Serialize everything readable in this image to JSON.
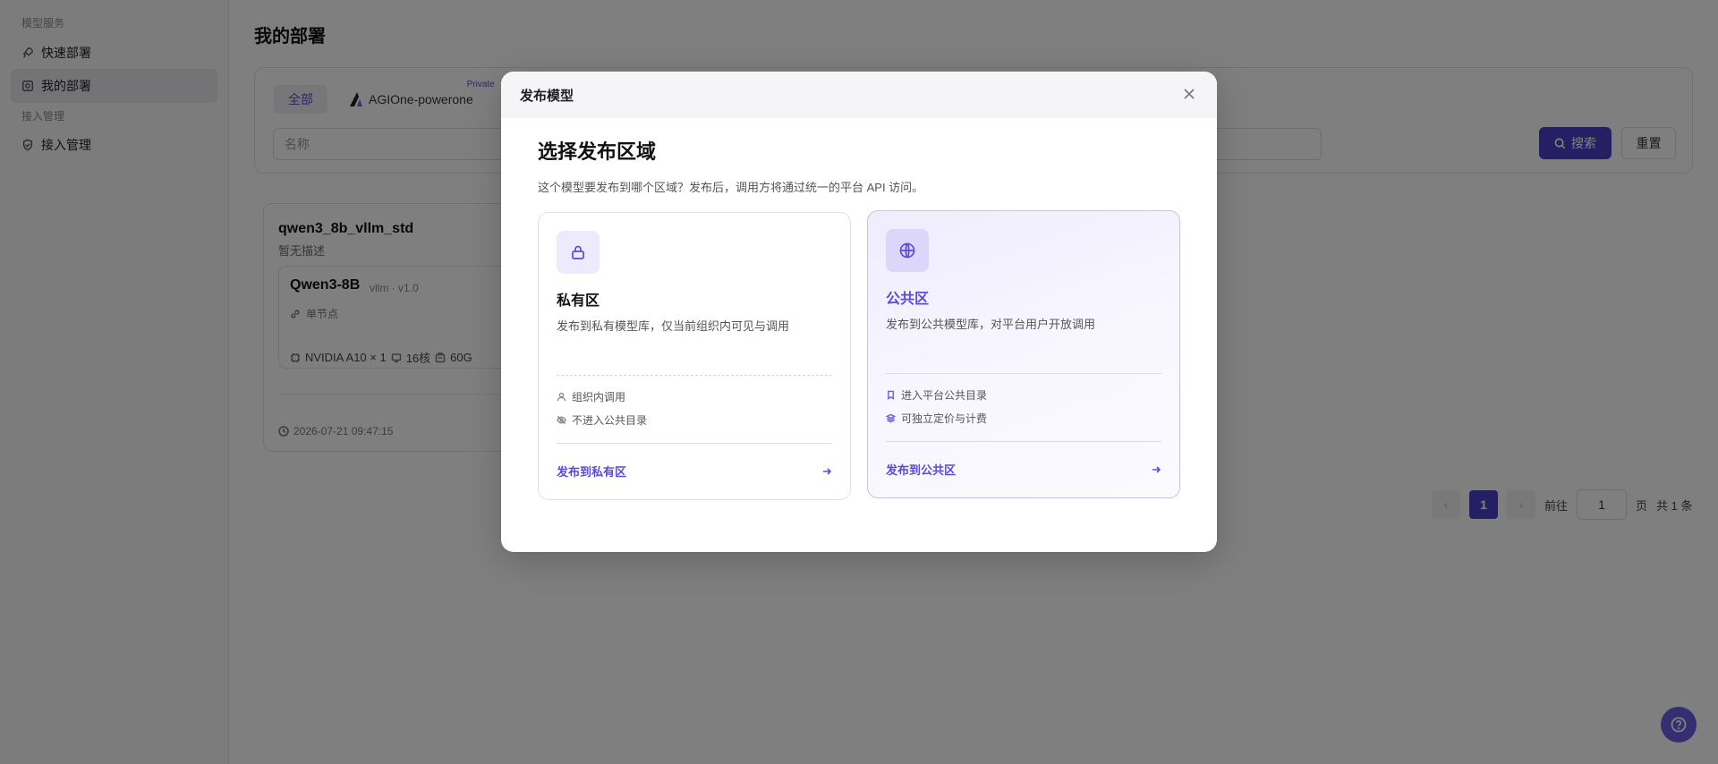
{
  "sidebar": {
    "group_model_service": "模型服务",
    "items": [
      {
        "label": "快速部署",
        "icon": "rocket-icon"
      },
      {
        "label": "我的部署",
        "icon": "deploy-icon",
        "active": true
      }
    ],
    "group_access": "接入管理",
    "access_items": [
      {
        "label": "接入管理",
        "icon": "shield-check-icon"
      }
    ]
  },
  "main": {
    "title": "我的部署",
    "tabs": [
      {
        "label": "全部",
        "active": true
      },
      {
        "label": "AGIOne-powerone",
        "badge": "Private"
      }
    ],
    "name_placeholder": "名称",
    "search_label": "搜索",
    "reset_label": "重置"
  },
  "deployment": {
    "name": "qwen3_8b_vllm_std",
    "description": "暂无描述",
    "model_name": "Qwen3-8B",
    "model_meta": "vllm · v1.0",
    "node_type": "单节点",
    "gpu": "NVIDIA A10 × 1",
    "cpu": "16核",
    "memory": "60G",
    "created_at": "2026-07-21 09:47:15"
  },
  "pagination": {
    "current_page": "1",
    "goto_label": "前往",
    "goto_value": "1",
    "page_label": "页",
    "total_label": "共 1 条"
  },
  "modal": {
    "title": "发布模型",
    "heading": "选择发布区域",
    "subtitle": "这个模型要发布到哪个区域？发布后，调用方将通过统一的平台 API 访问。",
    "private": {
      "title": "私有区",
      "description": "发布到私有模型库，仅当前组织内可见与调用",
      "features": [
        "组织内调用",
        "不进入公共目录"
      ],
      "action": "发布到私有区"
    },
    "public": {
      "title": "公共区",
      "description": "发布到公共模型库，对平台用户开放调用",
      "features": [
        "进入平台公共目录",
        "可独立定价与计费"
      ],
      "action": "发布到公共区"
    }
  },
  "colors": {
    "accent": "#5b4bd6",
    "primary_button": "#4b3fc9",
    "overlay": "rgba(0,0,0,0.5)"
  }
}
